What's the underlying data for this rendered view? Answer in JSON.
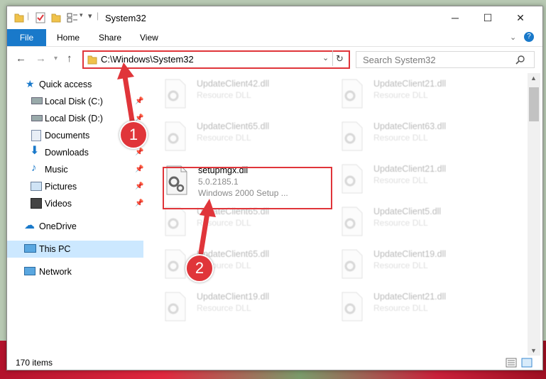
{
  "window": {
    "title": "System32"
  },
  "ribbon": {
    "file": "File",
    "tabs": [
      "Home",
      "Share",
      "View"
    ]
  },
  "address": {
    "path": "C:\\Windows\\System32"
  },
  "search": {
    "placeholder": "Search System32"
  },
  "nav": {
    "items": [
      {
        "label": "Quick access",
        "icon": "star-icon",
        "pinned": false
      },
      {
        "label": "Local Disk (C:)",
        "icon": "drive-icon",
        "pinned": true
      },
      {
        "label": "Local Disk (D:)",
        "icon": "drive-icon",
        "pinned": true
      },
      {
        "label": "Documents",
        "icon": "documents-icon",
        "pinned": true
      },
      {
        "label": "Downloads",
        "icon": "download-icon",
        "pinned": true
      },
      {
        "label": "Music",
        "icon": "music-icon",
        "pinned": true
      },
      {
        "label": "Pictures",
        "icon": "pictures-icon",
        "pinned": true
      },
      {
        "label": "Videos",
        "icon": "videos-icon",
        "pinned": true
      },
      {
        "label": "OneDrive",
        "icon": "cloud-icon",
        "pinned": false
      },
      {
        "label": "This PC",
        "icon": "computer-icon",
        "pinned": false,
        "selected": true
      },
      {
        "label": "Network",
        "icon": "network-icon",
        "pinned": false
      }
    ]
  },
  "files": {
    "left": [
      {
        "name": "UpdateClient42.dll",
        "type": "Resource DLL"
      },
      {
        "name": "UpdateClient65.dll",
        "type": "Resource DLL"
      },
      {
        "name": "setupmgx.dll",
        "version": "5.0.2185.1",
        "description": "Windows 2000 Setup ..."
      },
      {
        "name": "UpdateClient65.dll",
        "type": "Resource DLL"
      },
      {
        "name": "UpdateClient65.dll",
        "type": "Resource DLL"
      },
      {
        "name": "UpdateClient19.dll",
        "type": "Resource DLL"
      }
    ],
    "right": [
      {
        "name": "UpdateClient21.dll",
        "type": "Resource DLL"
      },
      {
        "name": "UpdateClient63.dll",
        "type": "Resource DLL"
      },
      {
        "name": "UpdateClient21.dll",
        "type": "Resource DLL"
      },
      {
        "name": "UpdateClient5.dll",
        "type": "Resource DLL"
      },
      {
        "name": "UpdateClient19.dll",
        "type": "Resource DLL"
      },
      {
        "name": "UpdateClient21.dll",
        "type": "Resource DLL"
      }
    ]
  },
  "status": {
    "items": "170 items"
  },
  "callouts": {
    "one": "1",
    "two": "2"
  },
  "colors": {
    "accent": "#1979ca",
    "highlight": "#e0353a",
    "selected_nav": "#cce8ff"
  }
}
